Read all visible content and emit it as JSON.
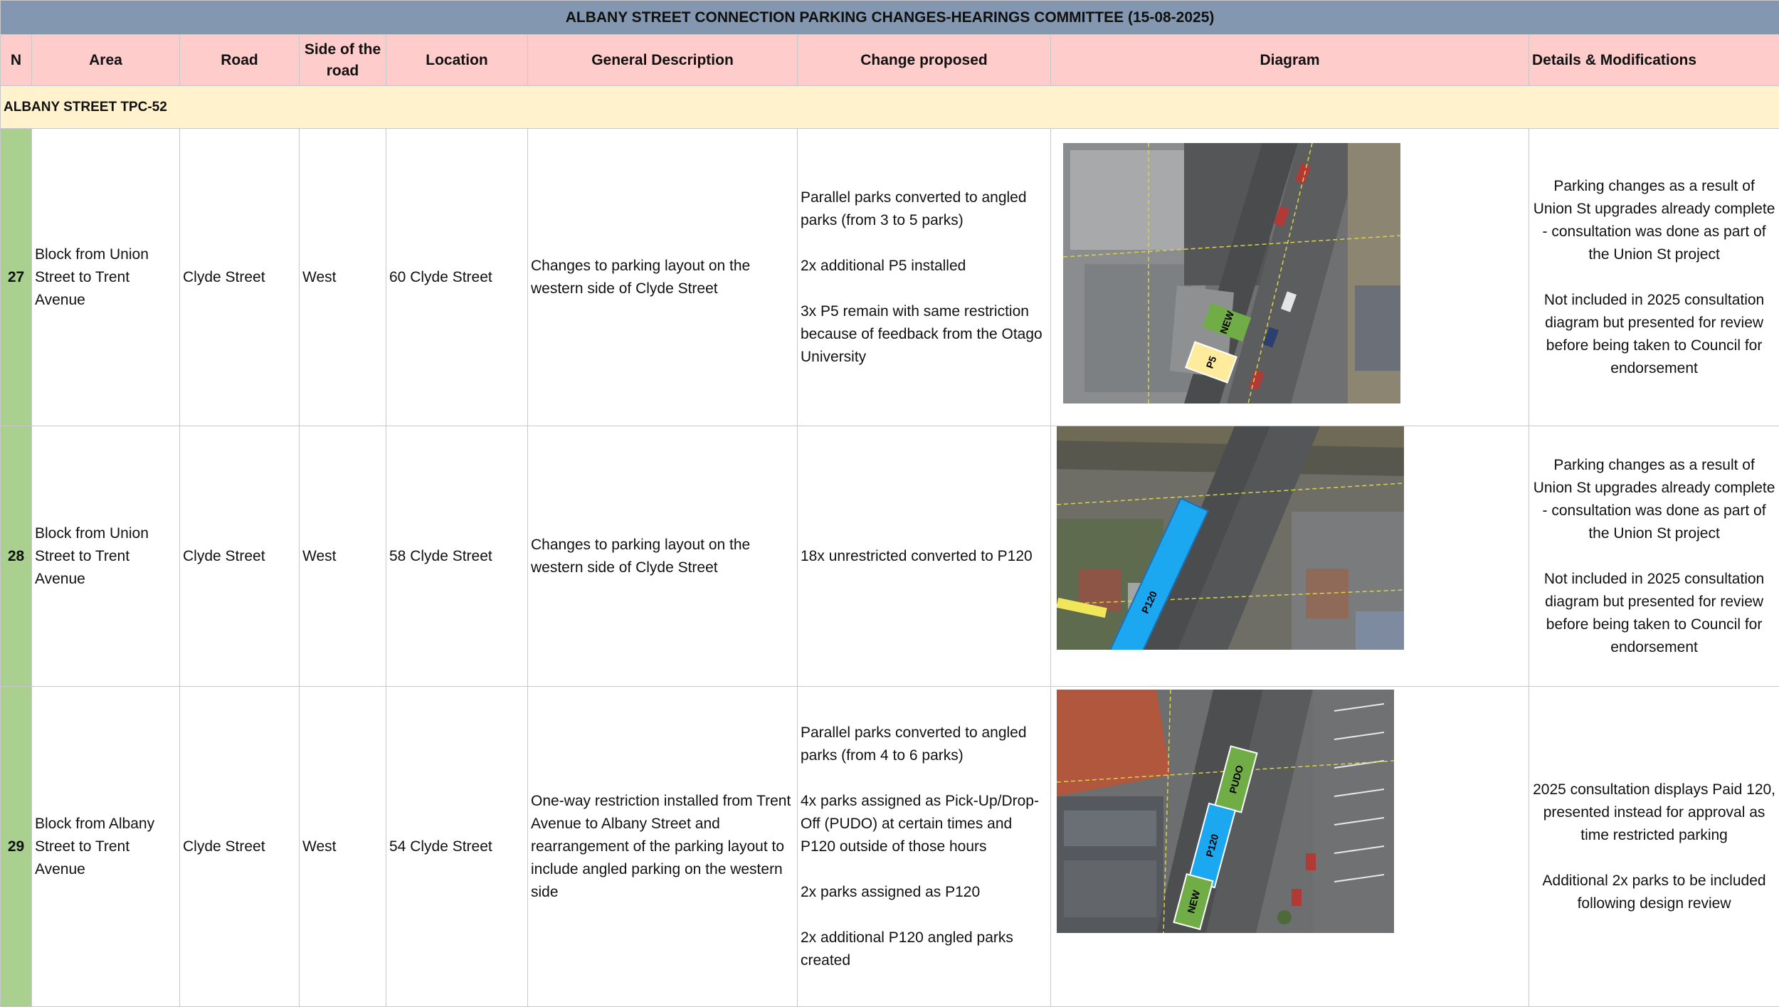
{
  "title": "ALBANY STREET CONNECTION PARKING CHANGES-HEARINGS COMMITTEE (15-08-2025)",
  "headers": {
    "n": "N",
    "area": "Area",
    "road": "Road",
    "side": "Side of the road",
    "location": "Location",
    "general": "General Description",
    "change": "Change proposed",
    "diagram": "Diagram",
    "details": "Details & Modifications"
  },
  "section": "ALBANY STREET TPC-52",
  "colors": {
    "title_bg": "#8497b0",
    "header_bg": "#ffcccc",
    "section_bg": "#fff2cc",
    "number_bg": "#a9d08e",
    "marker_green": "#70ad47",
    "marker_yellow": "#ffeb9c",
    "marker_blue": "#1ca8f0"
  },
  "rows": [
    {
      "n": "27",
      "area": "Block from Union Street to Trent Avenue",
      "road": "Clyde Street",
      "side": "West",
      "location": "60 Clyde Street",
      "general": "Changes to parking layout on the western side of Clyde Street",
      "change": [
        "Parallel parks converted to angled parks (from 3 to 5 parks)",
        "2x additional P5 installed",
        "3x P5 remain with same restriction because of feedback from the Otago University"
      ],
      "details": [
        "Parking changes as a result of Union St upgrades already complete - consultation was done as part of the Union St project",
        "Not included in 2025 consultation diagram but presented for review before being taken to Council for endorsement"
      ],
      "diagram_labels": [
        "NEW",
        "P5"
      ]
    },
    {
      "n": "28",
      "area": "Block from Union Street to Trent Avenue",
      "road": "Clyde Street",
      "side": "West",
      "location": "58 Clyde Street",
      "general": "Changes to parking layout on the western side of Clyde Street",
      "change": [
        "18x unrestricted converted to P120"
      ],
      "details": [
        "Parking changes as a result of Union St upgrades already complete - consultation was done as part of the Union St project",
        "Not included in 2025 consultation diagram but presented for review before being taken to Council for endorsement"
      ],
      "diagram_labels": [
        "P120"
      ]
    },
    {
      "n": "29",
      "area": "Block from Albany Street to Trent Avenue",
      "road": "Clyde Street",
      "side": "West",
      "location": "54 Clyde Street",
      "general": "One-way restriction installed from Trent Avenue to Albany Street and rearrangement of the parking layout to include angled parking on the western side",
      "change": [
        "Parallel parks converted to angled parks (from 4 to 6 parks)",
        "4x parks assigned as Pick-Up/Drop-Off (PUDO) at certain times and P120 outside of those hours",
        "2x parks assigned as P120",
        "2x additional P120 angled parks created"
      ],
      "details": [
        "2025 consultation displays Paid 120, presented instead for approval as time restricted parking",
        "Additional 2x parks to be included following design review"
      ],
      "diagram_labels": [
        "PUDO",
        "P120",
        "NEW"
      ]
    }
  ]
}
